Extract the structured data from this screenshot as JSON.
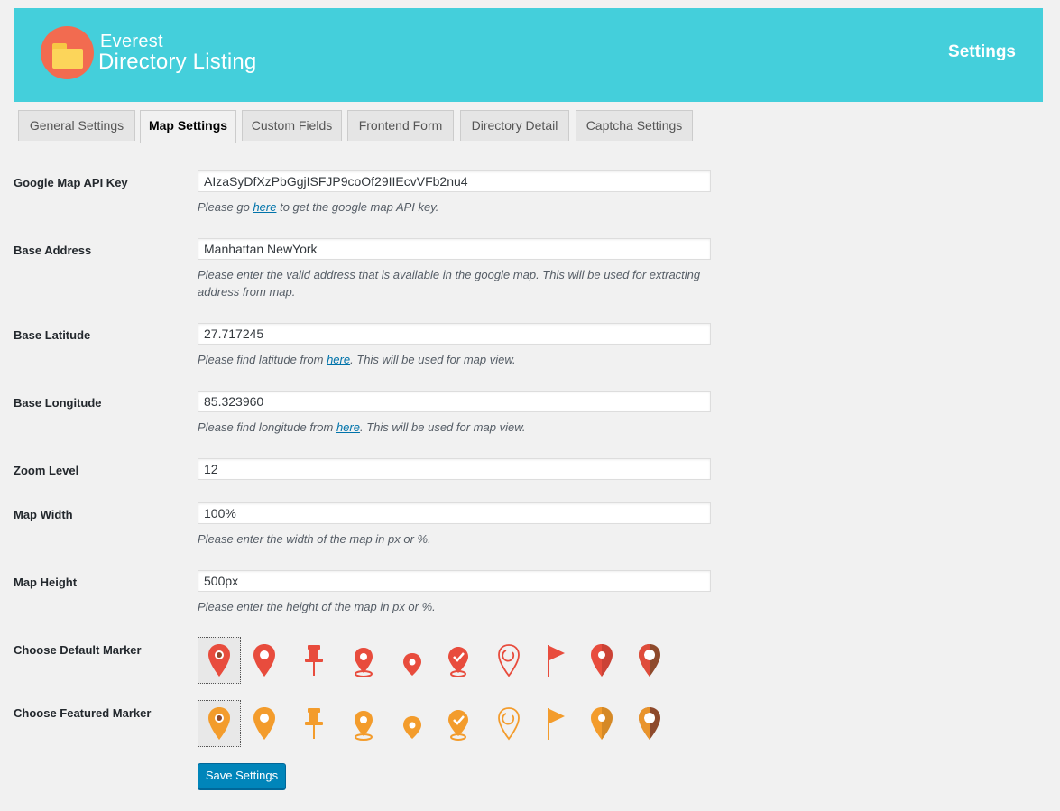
{
  "header": {
    "logo_line1": "Everest",
    "logo_line2": "Directory Listing",
    "title": "Settings"
  },
  "tabs": [
    {
      "label": "General Settings",
      "active": false
    },
    {
      "label": "Map Settings",
      "active": true
    },
    {
      "label": "Custom Fields",
      "active": false
    },
    {
      "label": "Frontend Form",
      "active": false
    },
    {
      "label": "Directory Detail",
      "active": false
    },
    {
      "label": "Captcha Settings",
      "active": false
    }
  ],
  "fields": {
    "api_key": {
      "label": "Google Map API Key",
      "value": "AIzaSyDfXzPbGgjISFJP9coOf29IIEcvVFb2nu4",
      "desc_before": "Please go ",
      "desc_link": "here",
      "desc_after": " to get the google map API key."
    },
    "base_address": {
      "label": "Base Address",
      "value": "Manhattan NewYork",
      "desc": "Please enter the valid address that is available in the google map. This will be used for extracting address from map."
    },
    "base_latitude": {
      "label": "Base Latitude",
      "value": "27.717245",
      "desc_before": "Please find latitude from ",
      "desc_link": "here",
      "desc_after": ". This will be used for map view."
    },
    "base_longitude": {
      "label": "Base Longitude",
      "value": "85.323960",
      "desc_before": "Please find longitude from ",
      "desc_link": "here",
      "desc_after": ". This will be used for map view."
    },
    "zoom_level": {
      "label": "Zoom Level",
      "value": "12"
    },
    "map_width": {
      "label": "Map Width",
      "value": "100%",
      "desc": "Please enter the width of the map in px or %."
    },
    "map_height": {
      "label": "Map Height",
      "value": "500px",
      "desc": "Please enter the height of the map in px or %."
    }
  },
  "default_marker": {
    "label": "Choose Default Marker",
    "color": "#e84c3d",
    "selected_index": 0,
    "icons": [
      "map-pin-icon",
      "map-pin-ring-icon",
      "push-pin-icon",
      "map-pin-base-icon",
      "map-pin-small-icon",
      "map-pin-check-icon",
      "map-pin-outline-icon",
      "flag-icon",
      "map-pin-dot-icon",
      "map-pin-brown-icon"
    ]
  },
  "featured_marker": {
    "label": "Choose Featured Marker",
    "color": "#f39c2c",
    "selected_index": 0,
    "icons": [
      "map-pin-icon",
      "map-pin-ring-icon",
      "push-pin-icon",
      "map-pin-base-icon",
      "map-pin-small-icon",
      "map-pin-check-icon",
      "map-pin-outline-icon",
      "flag-icon",
      "map-pin-dot-icon",
      "map-pin-brown-icon"
    ]
  },
  "save_button": "Save Settings"
}
